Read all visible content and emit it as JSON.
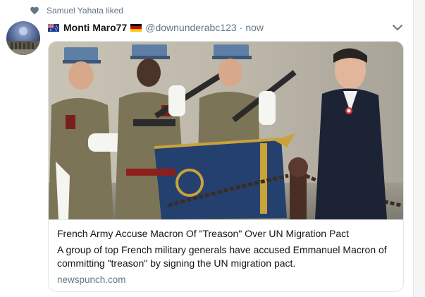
{
  "context": {
    "icon": "heart-icon",
    "text": "Samuel Yahata liked"
  },
  "tweet": {
    "author": {
      "display_name": "Monti Maro77",
      "handle": "@downunderabc123",
      "time": "now",
      "separator": "·",
      "leading_flag": "australia-flag-icon",
      "trailing_flag": "germany-flag-icon"
    },
    "menu_icon": "chevron-down-icon",
    "card": {
      "title": "French Army Accuse Macron Of \"Treason\" Over UN Migration Pact",
      "description": "A group of top French military generals have accused Emmanuel Macron of committing \"treason\" by signing the UN migration pact.",
      "domain": "newspunch.com"
    }
  },
  "colors": {
    "secondary_text": "#657786",
    "primary_text": "#14171a",
    "border": "#e1e8ed"
  }
}
